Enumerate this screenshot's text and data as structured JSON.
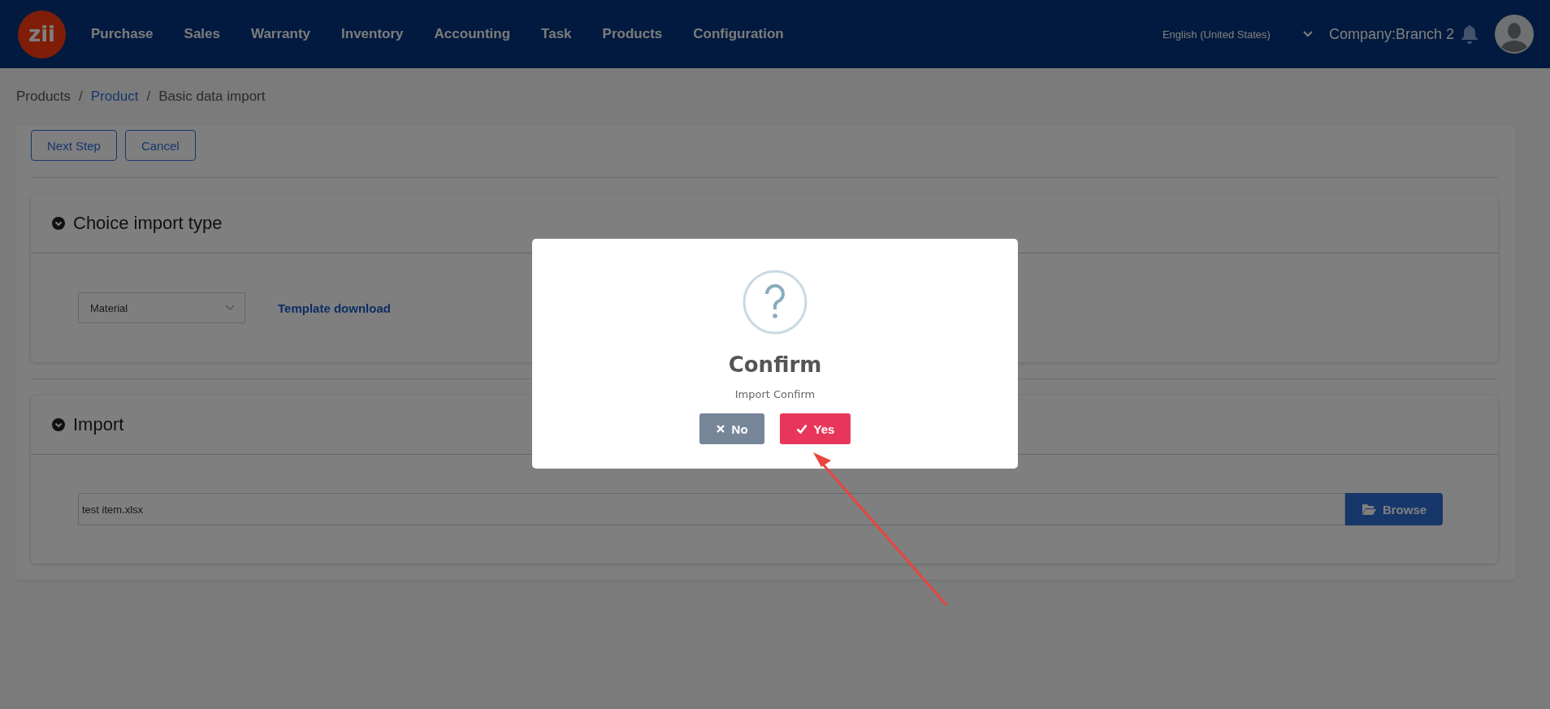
{
  "header": {
    "logo": "zii",
    "nav": [
      "Purchase",
      "Sales",
      "Warranty",
      "Inventory",
      "Accounting",
      "Task",
      "Products",
      "Configuration"
    ],
    "language": "English (United States)",
    "company": "Company:Branch 2"
  },
  "breadcrumb": [
    {
      "label": "Products",
      "kind": "text"
    },
    {
      "label": "/",
      "kind": "separator"
    },
    {
      "label": "Product",
      "kind": "link"
    },
    {
      "label": "/",
      "kind": "separator"
    },
    {
      "label": "Basic data import",
      "kind": "text"
    }
  ],
  "toolbar": [
    "Next Step",
    "Cancel"
  ],
  "sections": [
    {
      "title": "Choice import type",
      "expanded": true,
      "kind": "select",
      "value": "Material",
      "action": "Template download"
    },
    {
      "title": "Import",
      "expanded": true,
      "kind": "file",
      "value": "test item.xlsx",
      "action": "Browse"
    }
  ],
  "dialog": {
    "title": "Confirm",
    "message": "Import Confirm",
    "buttons": [
      {
        "label": "No",
        "kind": "cancel"
      },
      {
        "label": "Yes",
        "kind": "confirm"
      }
    ]
  }
}
